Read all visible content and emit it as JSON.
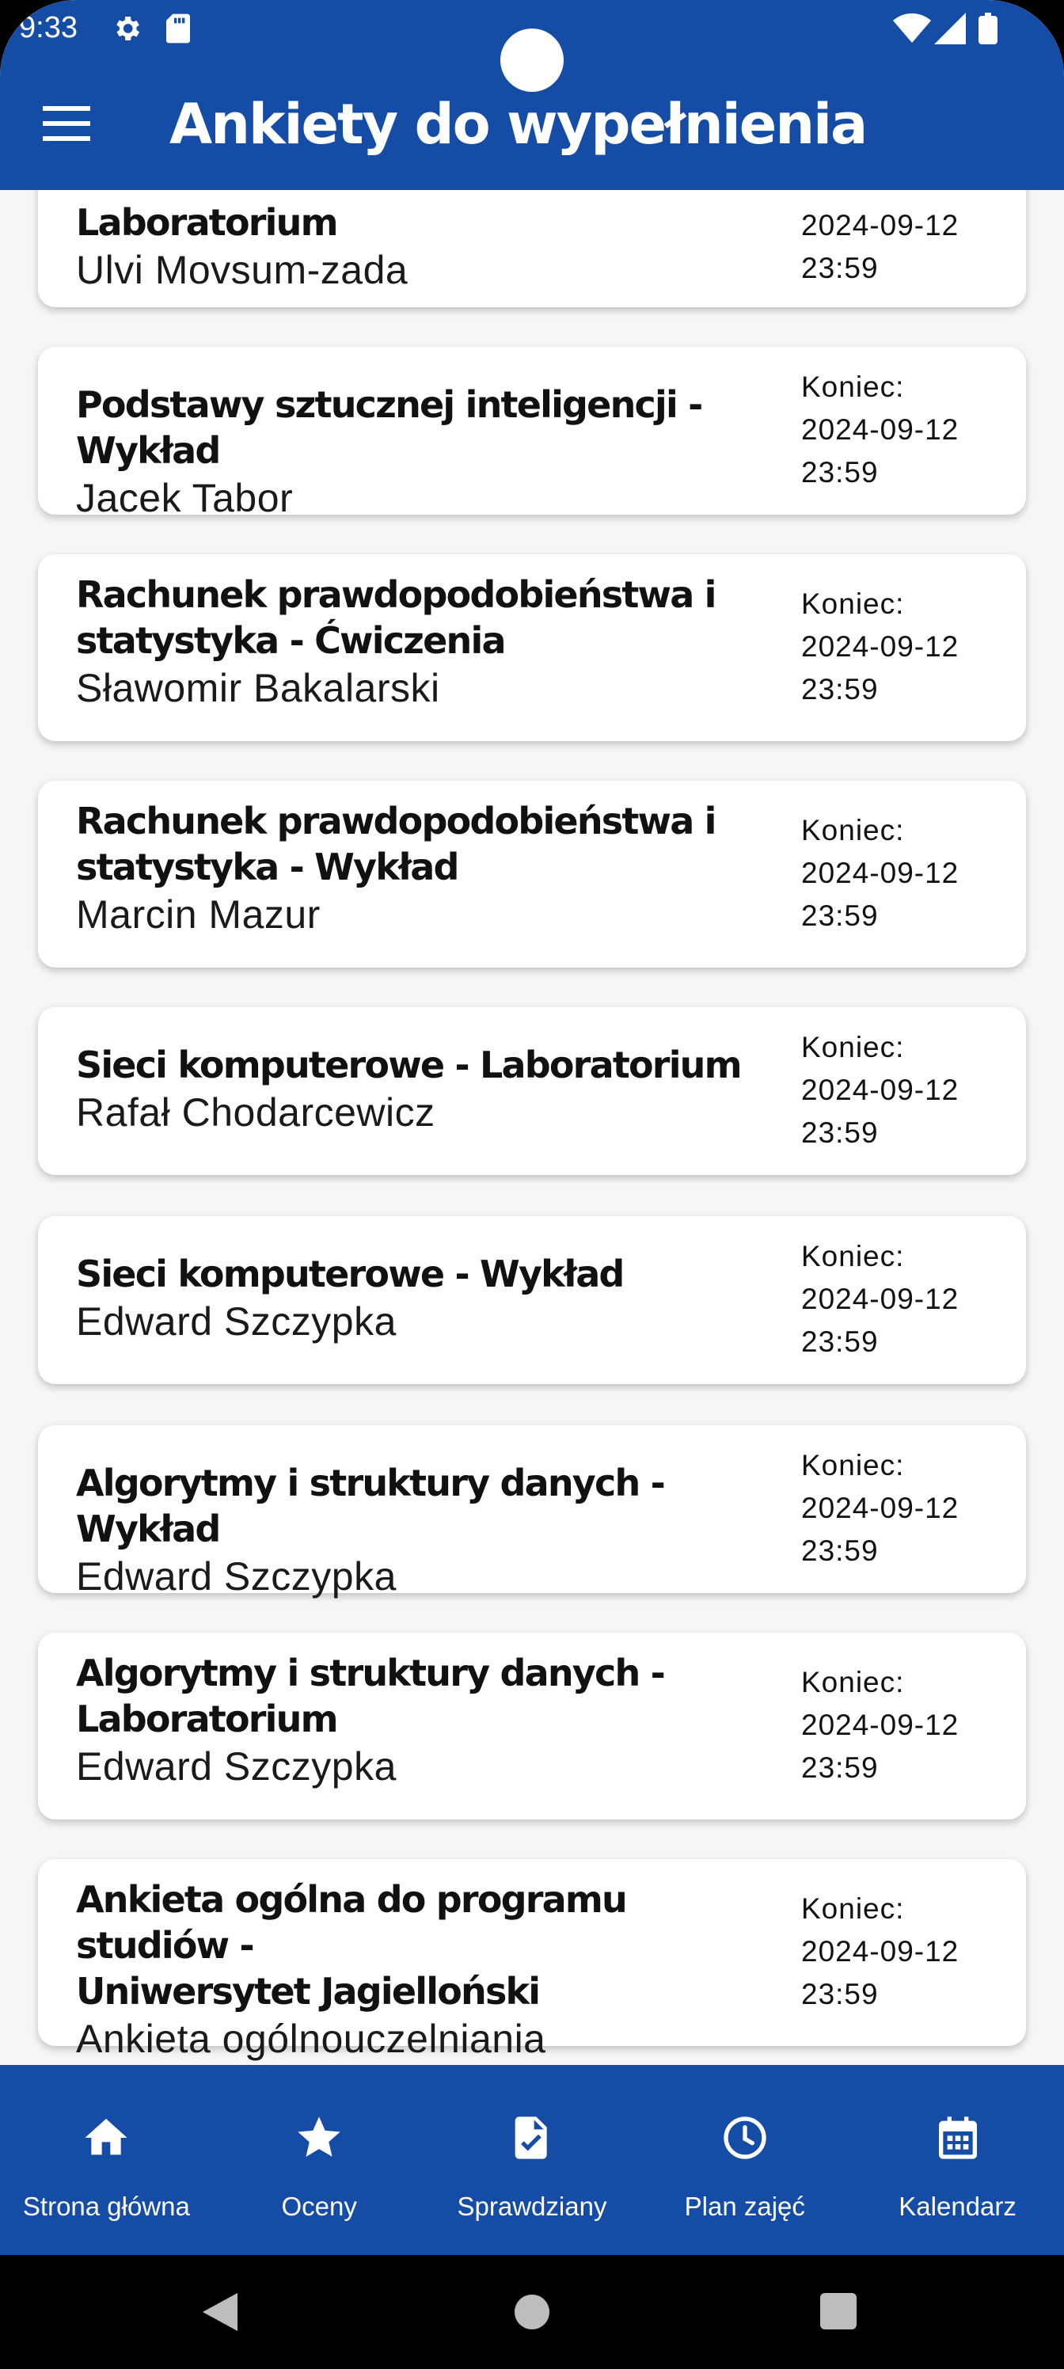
{
  "status_bar": {
    "time": "9:33",
    "icons": [
      "gear-icon",
      "sd-card-icon",
      "wifi-icon",
      "signal-icon",
      "battery-icon"
    ]
  },
  "app_bar": {
    "title": "Ankiety do wypełnienia",
    "menu_icon": "hamburger-menu-icon"
  },
  "surveys": [
    {
      "title_lines": [
        "Laboratorium"
      ],
      "person": "Ulvi Movsum-zada",
      "end_label": "",
      "end_date": "2024-09-12",
      "end_time": "23:59"
    },
    {
      "title_lines": [
        "Podstawy sztucznej inteligencji - Wykład"
      ],
      "person": "Jacek Tabor",
      "end_label": "Koniec:",
      "end_date": "2024-09-12",
      "end_time": "23:59"
    },
    {
      "title_lines": [
        "Rachunek prawdopodobieństwa i",
        "statystyka - Ćwiczenia"
      ],
      "person": "Sławomir Bakalarski",
      "end_label": "Koniec:",
      "end_date": "2024-09-12",
      "end_time": "23:59"
    },
    {
      "title_lines": [
        "Rachunek prawdopodobieństwa i",
        "statystyka - Wykład"
      ],
      "person": "Marcin Mazur",
      "end_label": "Koniec:",
      "end_date": "2024-09-12",
      "end_time": "23:59"
    },
    {
      "title_lines": [
        "Sieci komputerowe - Laboratorium"
      ],
      "person": "Rafał Chodarcewicz",
      "end_label": "Koniec:",
      "end_date": "2024-09-12",
      "end_time": "23:59"
    },
    {
      "title_lines": [
        "Sieci komputerowe - Wykład"
      ],
      "person": "Edward Szczypka",
      "end_label": "Koniec:",
      "end_date": "2024-09-12",
      "end_time": "23:59"
    },
    {
      "title_lines": [
        "Algorytmy i struktury danych - Wykład"
      ],
      "person": "Edward Szczypka",
      "end_label": "Koniec:",
      "end_date": "2024-09-12",
      "end_time": "23:59"
    },
    {
      "title_lines": [
        "Algorytmy i struktury danych -",
        "Laboratorium"
      ],
      "person": "Edward Szczypka",
      "end_label": "Koniec:",
      "end_date": "2024-09-12",
      "end_time": "23:59"
    },
    {
      "title_lines": [
        "Ankieta ogólna do programu studiów -",
        "Uniwersytet Jagielloński"
      ],
      "person": "Ankieta ogólnouczelniania",
      "end_label": "Koniec:",
      "end_date": "2024-09-12",
      "end_time": "23:59"
    }
  ],
  "bottom_nav": {
    "items": [
      {
        "label": "Strona główna",
        "icon": "home-icon"
      },
      {
        "label": "Oceny",
        "icon": "star-icon"
      },
      {
        "label": "Sprawdziany",
        "icon": "document-check-icon"
      },
      {
        "label": "Plan zajęć",
        "icon": "clock-icon"
      },
      {
        "label": "Kalendarz",
        "icon": "calendar-icon"
      }
    ]
  },
  "colors": {
    "primary": "#154da6",
    "background": "#f6f6f8",
    "card": "#ffffff",
    "text": "#111111"
  }
}
